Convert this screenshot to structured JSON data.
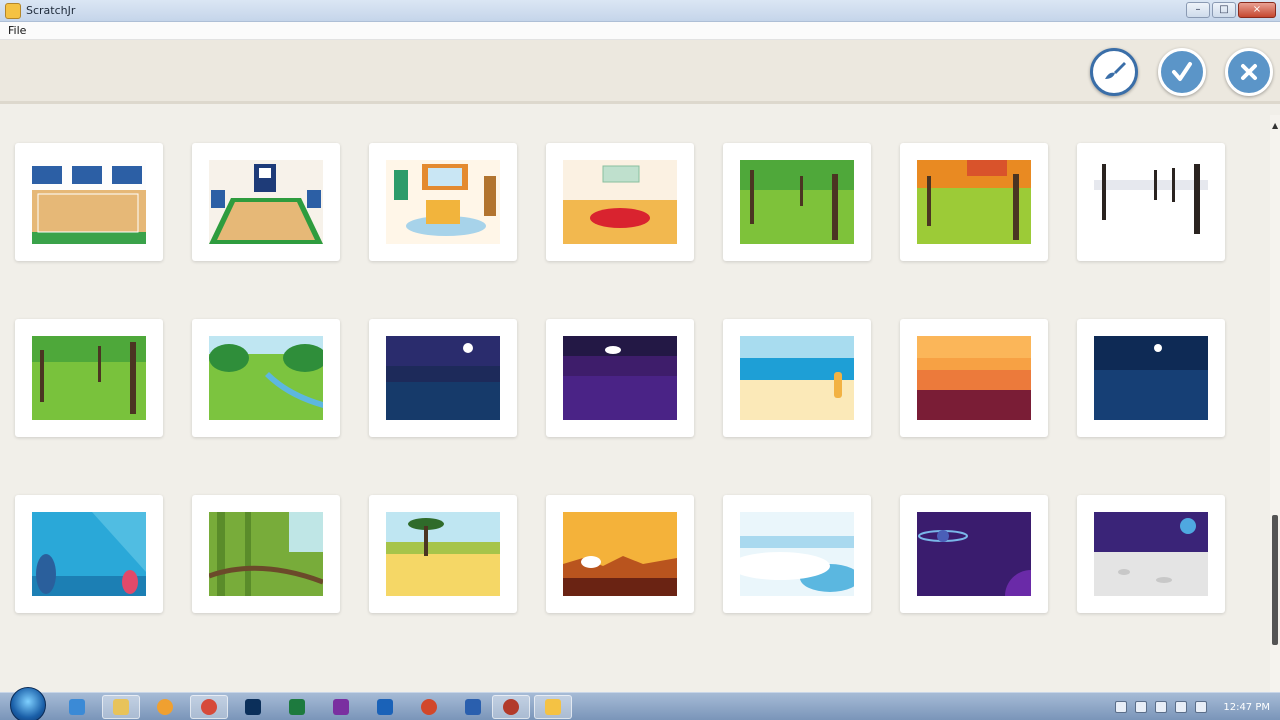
{
  "window": {
    "title": "ScratchJr",
    "minimize": "–",
    "maximize": "□",
    "close": "×"
  },
  "menu": {
    "file": "File"
  },
  "toolbar": {
    "paint_icon": "paintbrush-icon",
    "confirm_icon": "checkmark-icon",
    "close_icon": "close-icon",
    "accent": "#5b95c8"
  },
  "backgrounds": [
    "gym",
    "basketball-court",
    "bedroom",
    "room",
    "park",
    "autumn-forest",
    "winter-forest",
    "forest",
    "meadow-stream",
    "night-lake",
    "purple-night",
    "beach",
    "sunset-sea",
    "night-sea",
    "underwater",
    "jungle",
    "savanna",
    "desert",
    "arctic",
    "space",
    "moon"
  ],
  "taskbar": {
    "clock": "12:47 PM",
    "apps": [
      "ie",
      "explorer",
      "chrome-like",
      "chrome",
      "photoshop",
      "excel",
      "onenote",
      "outlook",
      "powerpoint",
      "word",
      "recorder",
      "scratchjr"
    ]
  }
}
